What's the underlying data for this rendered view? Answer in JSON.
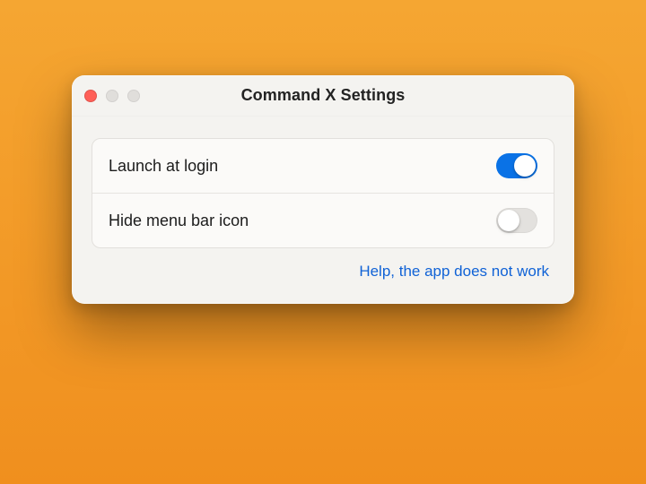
{
  "window": {
    "title": "Command X Settings"
  },
  "settings": {
    "launch_at_login": {
      "label": "Launch at login",
      "enabled": true
    },
    "hide_menubar_icon": {
      "label": "Hide menu bar icon",
      "enabled": false
    }
  },
  "help": {
    "label": "Help, the app does not work"
  },
  "colors": {
    "accent": "#0a72e6",
    "link": "#1062d6"
  }
}
